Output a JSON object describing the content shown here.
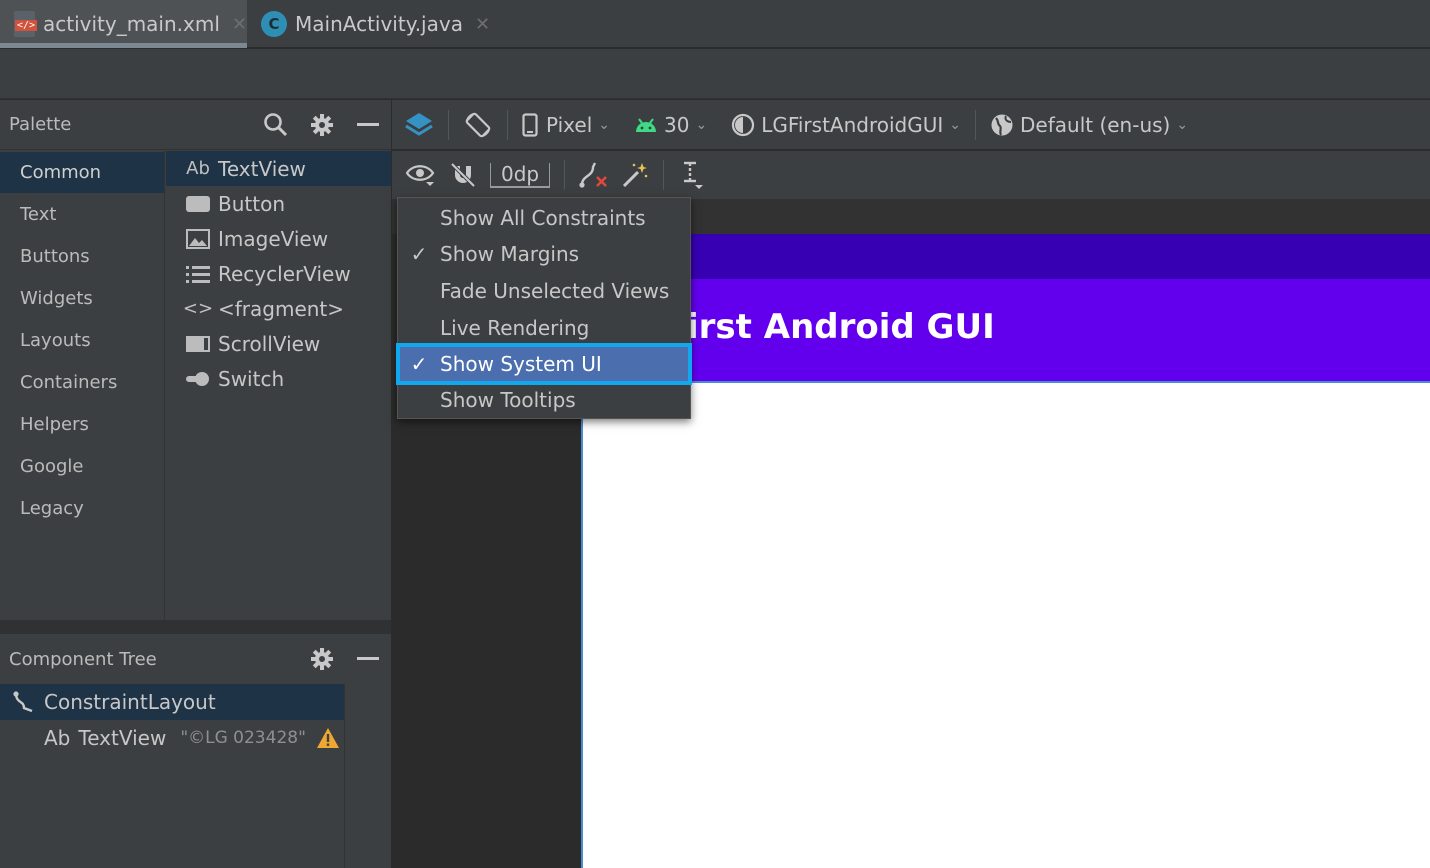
{
  "tabs": [
    {
      "label": "activity_main.xml",
      "icon": "xml-file-icon",
      "close": "✕"
    },
    {
      "label": "MainActivity.java",
      "icon": "java-class-icon",
      "close": "✕"
    }
  ],
  "palette": {
    "title": "Palette",
    "categories": [
      "Common",
      "Text",
      "Buttons",
      "Widgets",
      "Layouts",
      "Containers",
      "Helpers",
      "Google",
      "Legacy"
    ],
    "selected_category": "Common",
    "items": [
      {
        "icon_text": "Ab",
        "label": "TextView"
      },
      {
        "label": "Button"
      },
      {
        "label": "ImageView"
      },
      {
        "label": "RecyclerView"
      },
      {
        "icon_text": "<>",
        "label": "<fragment>"
      },
      {
        "label": "ScrollView"
      },
      {
        "label": "Switch"
      }
    ]
  },
  "component_tree": {
    "title": "Component Tree",
    "root": "ConstraintLayout",
    "child": {
      "icon_text": "Ab",
      "label": "TextView",
      "hint": "\"©LG 023428\""
    }
  },
  "toolbar": {
    "device": "Pixel",
    "api": "30",
    "theme": "LGFirstAndroidGUI",
    "locale": "Default (en-us)",
    "margin": "0dp"
  },
  "menu": {
    "items": [
      {
        "label": "Show All Constraints",
        "checked": false
      },
      {
        "label": "Show Margins",
        "checked": true
      },
      {
        "label": "Fade Unselected Views",
        "checked": false
      },
      {
        "label": "Live Rendering",
        "checked": false
      },
      {
        "label": "Show System UI",
        "checked": true,
        "highlighted": true
      },
      {
        "label": "Show Tooltips",
        "checked": false
      }
    ],
    "check_glyph": "✓"
  },
  "preview": {
    "app_title": "irst Android GUI",
    "status_bar_color": "#3700b3",
    "app_bar_color": "#6200ee"
  }
}
